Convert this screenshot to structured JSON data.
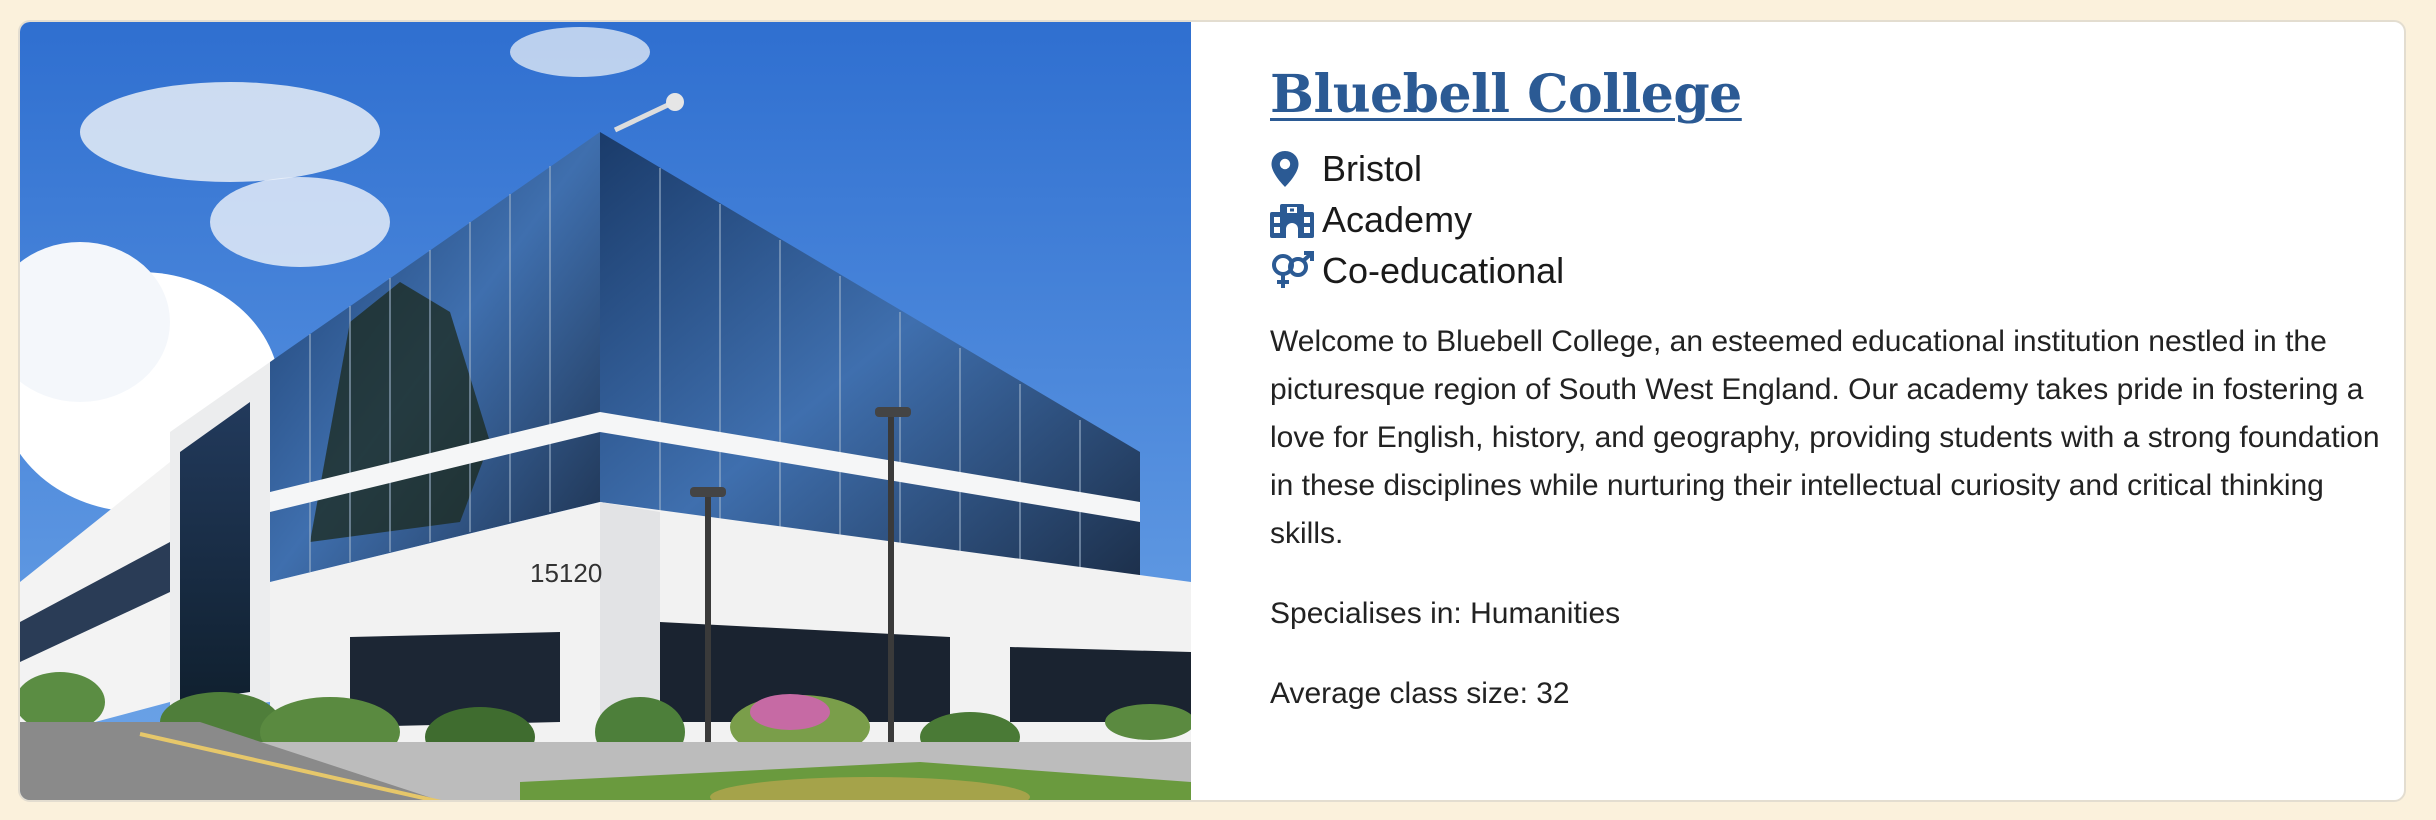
{
  "school": {
    "name": "Bluebell College",
    "location": "Bristol",
    "type": "Academy",
    "gender": "Co-educational",
    "description": "Welcome to Bluebell College, an esteemed educational institution nestled in the picturesque region of South West England. Our academy takes pride in fostering a love for English, history, and geography, providing students with a strong foundation in these disciplines while nurturing their intellectual curiosity and critical thinking skills.",
    "specialism": "Specialises in: Humanities",
    "class_size": "Average class size: 32",
    "building_number": "15120"
  },
  "icons": {
    "location": "map-pin-icon",
    "type": "school-building-icon",
    "gender": "venus-mars-icon"
  },
  "colors": {
    "page_background": "#fbf1dc",
    "accent": "#2b5a94",
    "text": "#222222"
  }
}
